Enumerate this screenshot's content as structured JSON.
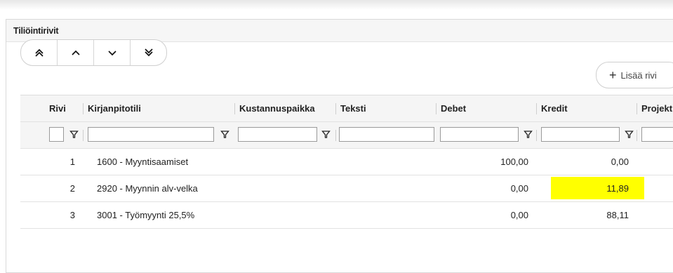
{
  "panel": {
    "title": "Tiliöintirivit"
  },
  "nav": [
    {
      "name": "first-row-button",
      "icon": "double-chevron-up-icon"
    },
    {
      "name": "prev-row-button",
      "icon": "chevron-up-icon"
    },
    {
      "name": "next-row-button",
      "icon": "chevron-down-icon"
    },
    {
      "name": "last-row-button",
      "icon": "double-chevron-down-icon"
    }
  ],
  "add_row": {
    "icon": "plus-icon",
    "label": "Lisää rivi"
  },
  "table": {
    "headers": {
      "rivi": "Rivi",
      "kirjanpitotili": "Kirjanpitotili",
      "kustannuspaikka": "Kustannuspaikka",
      "teksti": "Teksti",
      "debet": "Debet",
      "kredit": "Kredit",
      "projekti": "Projekti"
    },
    "rows": [
      {
        "rivi": "1",
        "tili": "1600 - Myyntisaamiset",
        "debet": "100,00",
        "kredit": "0,00"
      },
      {
        "rivi": "2",
        "tili": "2920 - Myynnin alv-velka",
        "debet": "0,00",
        "kredit": "11,89"
      },
      {
        "rivi": "3",
        "tili": "3001 - Työmyynti 25,5%",
        "debet": "0,00",
        "kredit": "88,11"
      }
    ],
    "highlight_color": "#ffff00"
  }
}
